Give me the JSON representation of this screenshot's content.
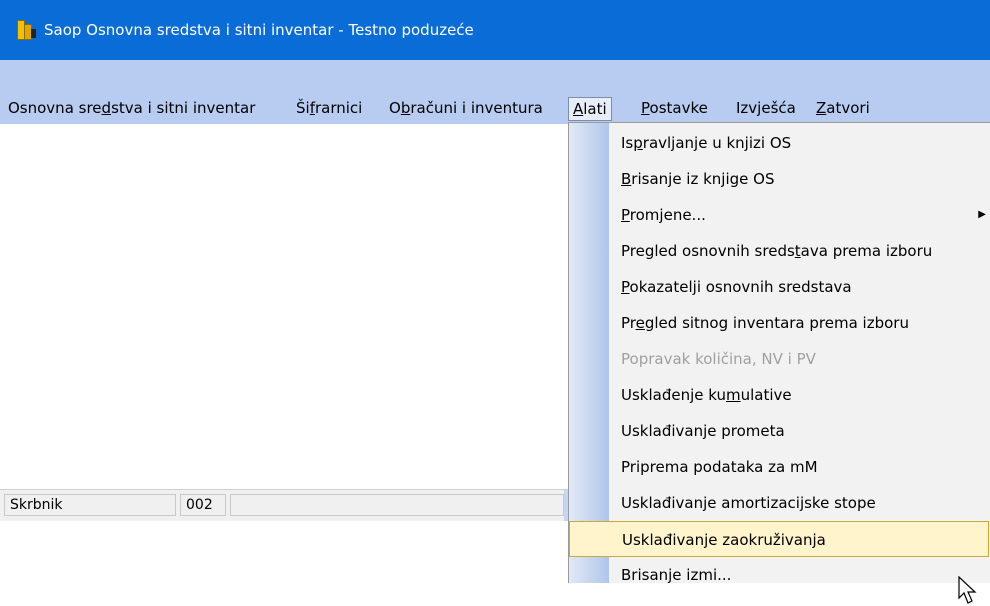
{
  "window": {
    "title": "Saop Osnovna sredstva i sitni inventar - Testno poduzeće"
  },
  "menubar": {
    "items": [
      {
        "label": "Osnovna sredstva i sitni inventar",
        "access": "d"
      },
      {
        "label": "Šifrarnici",
        "access": "f"
      },
      {
        "label": "Obračuni i inventura",
        "access": "b"
      },
      {
        "label": "Alati",
        "access": "A",
        "active": true
      },
      {
        "label": "Postavke",
        "access": "P"
      },
      {
        "label": "Izvješća",
        "access": ""
      },
      {
        "label": "Zatvori",
        "access": "Z"
      }
    ]
  },
  "dropdown": {
    "items": [
      {
        "label": "Ispravljanje u knjizi OS",
        "access": "p"
      },
      {
        "label": "Brisanje iz knjige OS",
        "access": "B"
      },
      {
        "label": "Promjene...",
        "access": "P",
        "submenu": true
      },
      {
        "label": "Pregled osnovnih sredstava prema izboru",
        "access": "t"
      },
      {
        "label": "Pokazatelji osnovnih sredstava",
        "access": "P"
      },
      {
        "label": "Pregled sitnog inventara prema izboru",
        "access": "e"
      },
      {
        "label": "Popravak količina, NV i PV",
        "access": "",
        "disabled": true
      },
      {
        "label": "Usklađenje kumulative",
        "access": "m"
      },
      {
        "label": "Usklađivanje prometa",
        "access": ""
      },
      {
        "label": "Priprema podataka za mM",
        "access": ""
      },
      {
        "label": "Usklađivanje amortizacijske stope",
        "access": ""
      },
      {
        "label": "Usklađivanje zaokruživanja",
        "access": "",
        "hovered": true
      },
      {
        "label": "Brisanje izmi...",
        "access": ""
      }
    ],
    "submenu_arrow": "▶"
  },
  "statusbar": {
    "user": "Skrbnik",
    "code": "002"
  },
  "colors": {
    "titlebar": "#0a6cd6",
    "menubar": "#b7ccf0",
    "hover": "#fff4cc"
  }
}
